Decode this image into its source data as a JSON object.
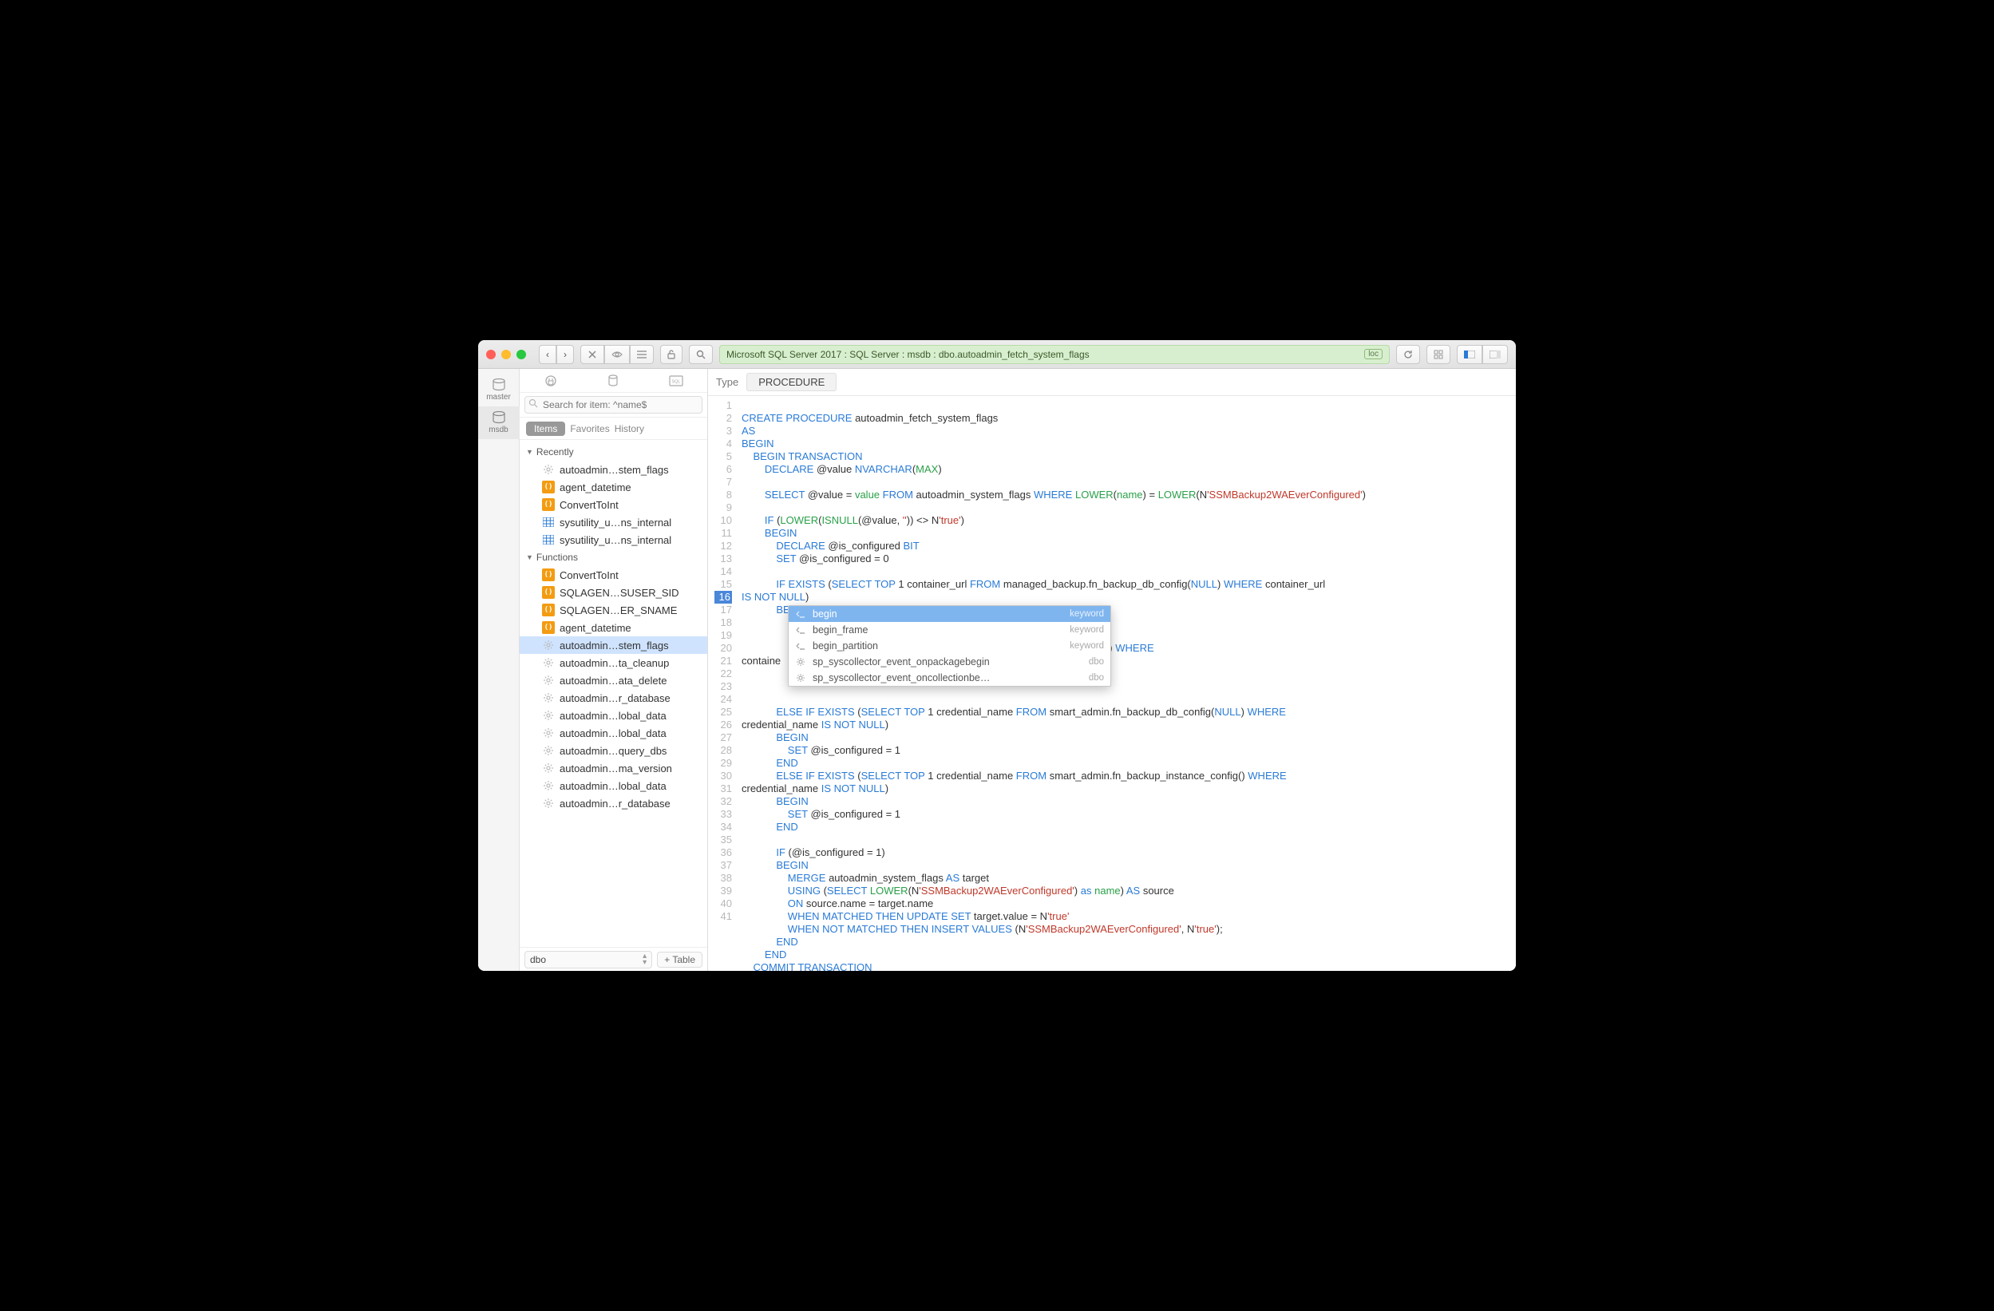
{
  "breadcrumb": "Microsoft SQL Server 2017 : SQL Server : msdb : dbo.autoadmin_fetch_system_flags",
  "breadcrumb_badge": "loc",
  "rail": [
    {
      "label": "master"
    },
    {
      "label": "msdb"
    }
  ],
  "search_placeholder": "Search for item: ^name$",
  "tabs": {
    "items": "Items",
    "favorites": "Favorites",
    "history": "History"
  },
  "tree": {
    "recently_header": "Recently",
    "recently": [
      {
        "icon": "gear",
        "label": "autoadmin…stem_flags"
      },
      {
        "icon": "fn",
        "label": "agent_datetime"
      },
      {
        "icon": "fn",
        "label": "ConvertToInt"
      },
      {
        "icon": "tbl",
        "label": "sysutility_u…ns_internal"
      },
      {
        "icon": "tbl",
        "label": "sysutility_u…ns_internal"
      }
    ],
    "functions_header": "Functions",
    "functions": [
      {
        "icon": "fn",
        "label": "ConvertToInt"
      },
      {
        "icon": "fn",
        "label": "SQLAGEN…SUSER_SID"
      },
      {
        "icon": "fn",
        "label": "SQLAGEN…ER_SNAME"
      },
      {
        "icon": "fn",
        "label": "agent_datetime"
      },
      {
        "icon": "gear",
        "label": "autoadmin…stem_flags",
        "sel": true
      },
      {
        "icon": "gear",
        "label": "autoadmin…ta_cleanup"
      },
      {
        "icon": "gear",
        "label": "autoadmin…ata_delete"
      },
      {
        "icon": "gear",
        "label": "autoadmin…r_database"
      },
      {
        "icon": "gear",
        "label": "autoadmin…lobal_data"
      },
      {
        "icon": "gear",
        "label": "autoadmin…lobal_data"
      },
      {
        "icon": "gear",
        "label": "autoadmin…query_dbs"
      },
      {
        "icon": "gear",
        "label": "autoadmin…ma_version"
      },
      {
        "icon": "gear",
        "label": "autoadmin…lobal_data"
      },
      {
        "icon": "gear",
        "label": "autoadmin…r_database"
      }
    ]
  },
  "schema_select": "dbo",
  "add_table": "+ Table",
  "type_label": "Type",
  "type_value": "PROCEDURE",
  "popup": [
    {
      "name": "begin",
      "meta": "keyword",
      "sel": true,
      "icon": "kw"
    },
    {
      "name": "begin_frame",
      "meta": "keyword",
      "icon": "kw"
    },
    {
      "name": "begin_partition",
      "meta": "keyword",
      "icon": "kw"
    },
    {
      "name": "sp_syscollector_event_onpackagebegin",
      "meta": "dbo",
      "icon": "gear"
    },
    {
      "name": "sp_syscollector_event_oncollectionbe…",
      "meta": "dbo",
      "icon": "gear"
    }
  ],
  "code_lines": 41
}
